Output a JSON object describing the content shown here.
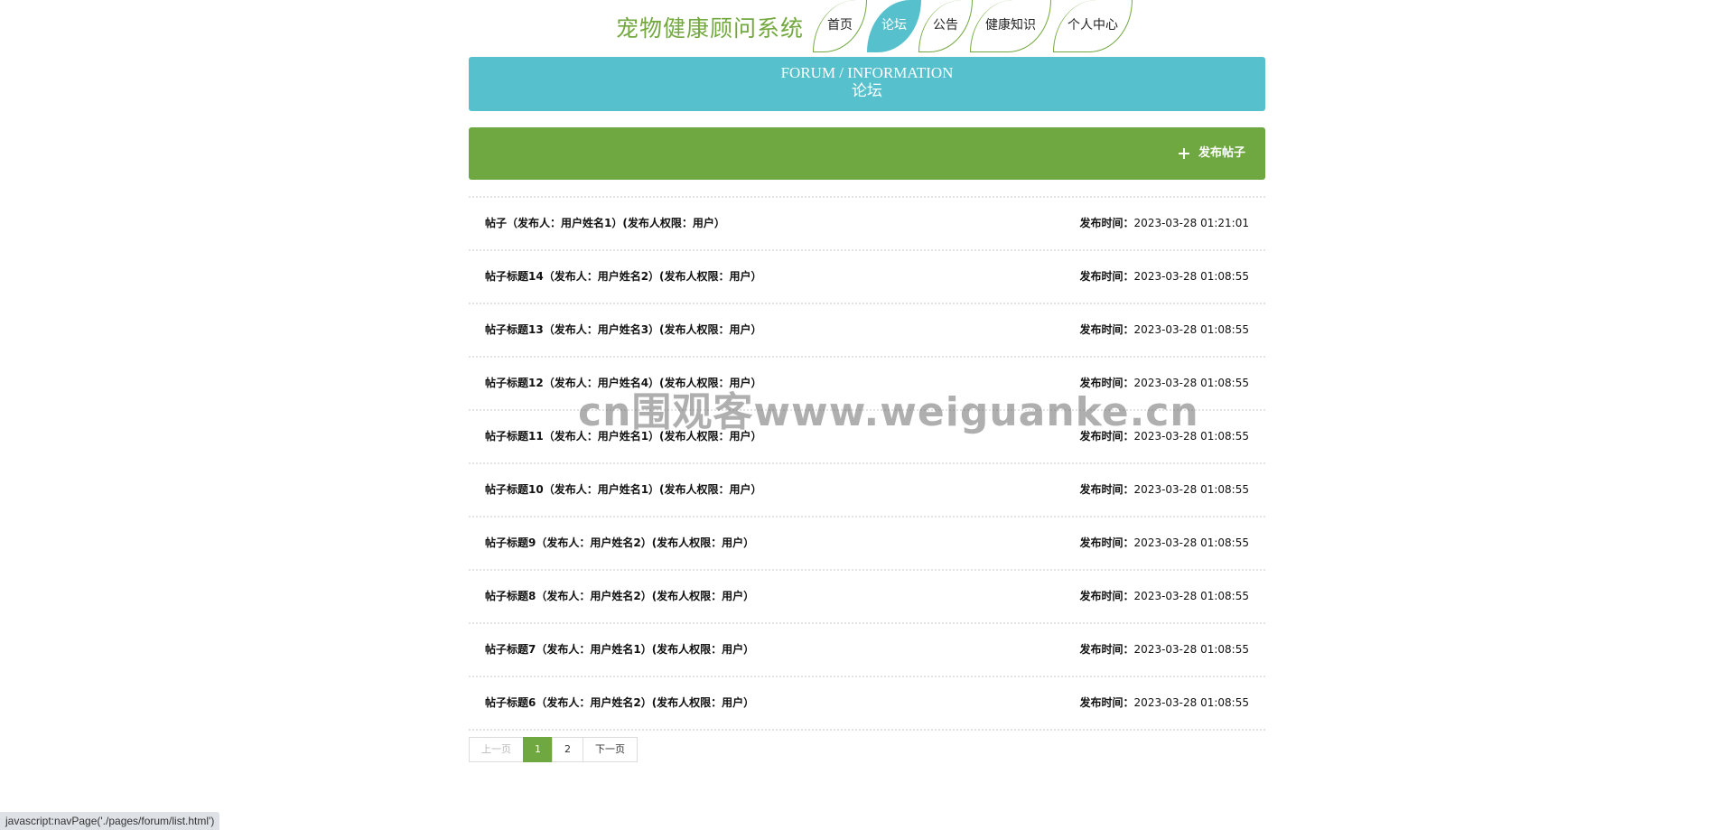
{
  "header": {
    "site_title": "宠物健康顾问系统",
    "nav": [
      {
        "label": "首页",
        "active": false
      },
      {
        "label": "论坛",
        "active": true
      },
      {
        "label": "公告",
        "active": false
      },
      {
        "label": "健康知识",
        "active": false
      },
      {
        "label": "个人中心",
        "active": false
      }
    ]
  },
  "banner": {
    "en": "FORUM / INFORMATION",
    "cn": "论坛"
  },
  "toolbar": {
    "post_label": "发布帖子",
    "post_icon": "plus-icon"
  },
  "posts": [
    {
      "title": "帖子（发布人：用户姓名1）(发布人权限：用户）",
      "time_label": "发布时间：",
      "time": "2023-03-28 01:21:01"
    },
    {
      "title": "帖子标题14（发布人：用户姓名2）(发布人权限：用户）",
      "time_label": "发布时间：",
      "time": "2023-03-28 01:08:55"
    },
    {
      "title": "帖子标题13（发布人：用户姓名3）(发布人权限：用户）",
      "time_label": "发布时间：",
      "time": "2023-03-28 01:08:55"
    },
    {
      "title": "帖子标题12（发布人：用户姓名4）(发布人权限：用户）",
      "time_label": "发布时间：",
      "time": "2023-03-28 01:08:55"
    },
    {
      "title": "帖子标题11（发布人：用户姓名1）(发布人权限：用户）",
      "time_label": "发布时间：",
      "time": "2023-03-28 01:08:55"
    },
    {
      "title": "帖子标题10（发布人：用户姓名1）(发布人权限：用户）",
      "time_label": "发布时间：",
      "time": "2023-03-28 01:08:55"
    },
    {
      "title": "帖子标题9（发布人：用户姓名2）(发布人权限：用户）",
      "time_label": "发布时间：",
      "time": "2023-03-28 01:08:55"
    },
    {
      "title": "帖子标题8（发布人：用户姓名2）(发布人权限：用户）",
      "time_label": "发布时间：",
      "time": "2023-03-28 01:08:55"
    },
    {
      "title": "帖子标题7（发布人：用户姓名1）(发布人权限：用户）",
      "time_label": "发布时间：",
      "time": "2023-03-28 01:08:55"
    },
    {
      "title": "帖子标题6（发布人：用户姓名2）(发布人权限：用户）",
      "time_label": "发布时间：",
      "time": "2023-03-28 01:08:55"
    }
  ],
  "pagination": {
    "prev": "上一页",
    "pages": [
      "1",
      "2"
    ],
    "current": "1",
    "next": "下一页"
  },
  "watermark": "cn围观客www.weiguanke.cn",
  "statusbar": "javascript:navPage('./pages/forum/list.html')",
  "colors": {
    "brand_green": "#72a83f",
    "accent_teal": "#56c1cc",
    "action_green": "#6fa840"
  }
}
